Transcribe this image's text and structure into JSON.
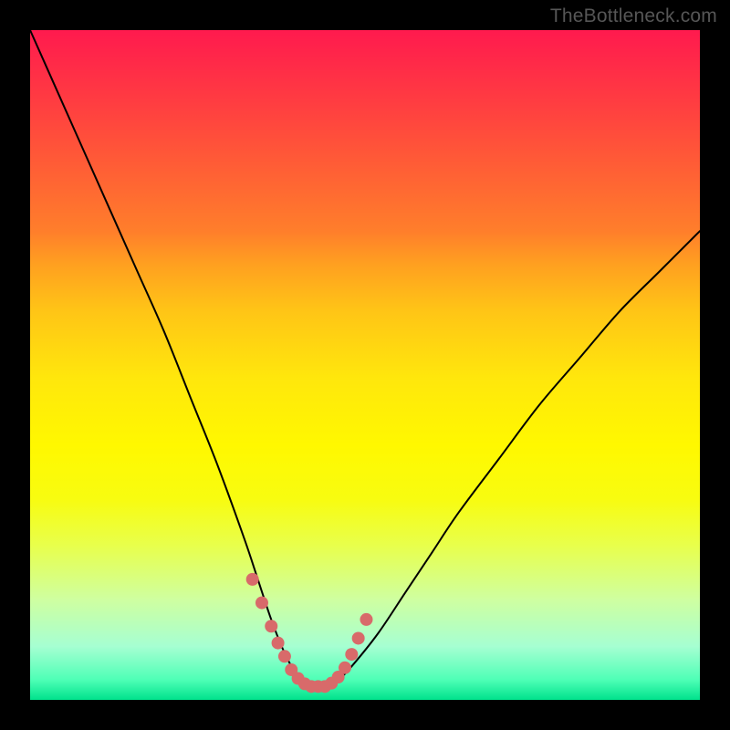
{
  "watermark": "TheBottleneck.com",
  "chart_data": {
    "type": "line",
    "title": "",
    "xlabel": "",
    "ylabel": "",
    "xlim": [
      0,
      100
    ],
    "ylim": [
      0,
      100
    ],
    "series": [
      {
        "name": "bottleneck-curve",
        "x": [
          0,
          4,
          8,
          12,
          16,
          20,
          24,
          28,
          32,
          34,
          36,
          38,
          40,
          42,
          44,
          46,
          48,
          52,
          56,
          60,
          64,
          70,
          76,
          82,
          88,
          94,
          100
        ],
        "y": [
          100,
          91,
          82,
          73,
          64,
          55,
          45,
          35,
          24,
          18,
          12,
          7,
          3.5,
          2,
          2,
          3,
          5,
          10,
          16,
          22,
          28,
          36,
          44,
          51,
          58,
          64,
          70
        ]
      }
    ],
    "highlight": {
      "name": "trough-band",
      "color": "#d86a6a",
      "x": [
        33.2,
        34.6,
        36.0,
        37.0,
        38.0,
        39.0,
        40.0,
        41.0,
        42.0,
        43.0,
        44.0,
        45.0,
        46.0,
        47.0,
        48.0,
        49.0,
        50.2
      ],
      "y": [
        18.0,
        14.5,
        11.0,
        8.5,
        6.5,
        4.5,
        3.2,
        2.4,
        2.0,
        2.0,
        2.0,
        2.5,
        3.4,
        4.8,
        6.8,
        9.2,
        12.0
      ]
    },
    "gradient_stops": [
      {
        "pos": 0.0,
        "color": "#ff1a4e"
      },
      {
        "pos": 0.35,
        "color": "#ffa020"
      },
      {
        "pos": 0.62,
        "color": "#fff800"
      },
      {
        "pos": 0.92,
        "color": "#a6ffd2"
      },
      {
        "pos": 1.0,
        "color": "#00e28c"
      }
    ]
  }
}
